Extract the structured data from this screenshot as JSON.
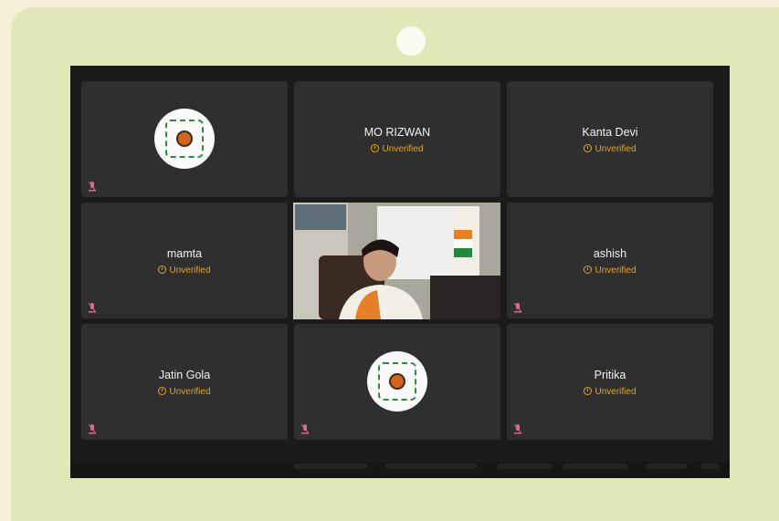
{
  "participants": [
    {
      "name": "",
      "status": "",
      "avatar": "logo-icon"
    },
    {
      "name": "MO RIZWAN",
      "status": "Unverified"
    },
    {
      "name": "Kanta Devi",
      "status": "Unverified"
    },
    {
      "name": "mamta",
      "status": "Unverified"
    },
    {
      "name": "",
      "status": "",
      "video": true
    },
    {
      "name": "ashish",
      "status": "Unverified"
    },
    {
      "name": "Jatin Gola",
      "status": "Unverified"
    },
    {
      "name": "",
      "status": "",
      "avatar": "logo-icon"
    },
    {
      "name": "Pritika",
      "status": "Unverified"
    }
  ],
  "colors": {
    "status": "#e8a317",
    "mic_muted": "#d96b8a",
    "tile_bg": "#2f2f2f",
    "screen_bg": "#1b1b1b",
    "frame_bg": "#e2e7b7"
  },
  "icons": {
    "status": "clock-icon",
    "mic": "mic-muted-icon"
  }
}
